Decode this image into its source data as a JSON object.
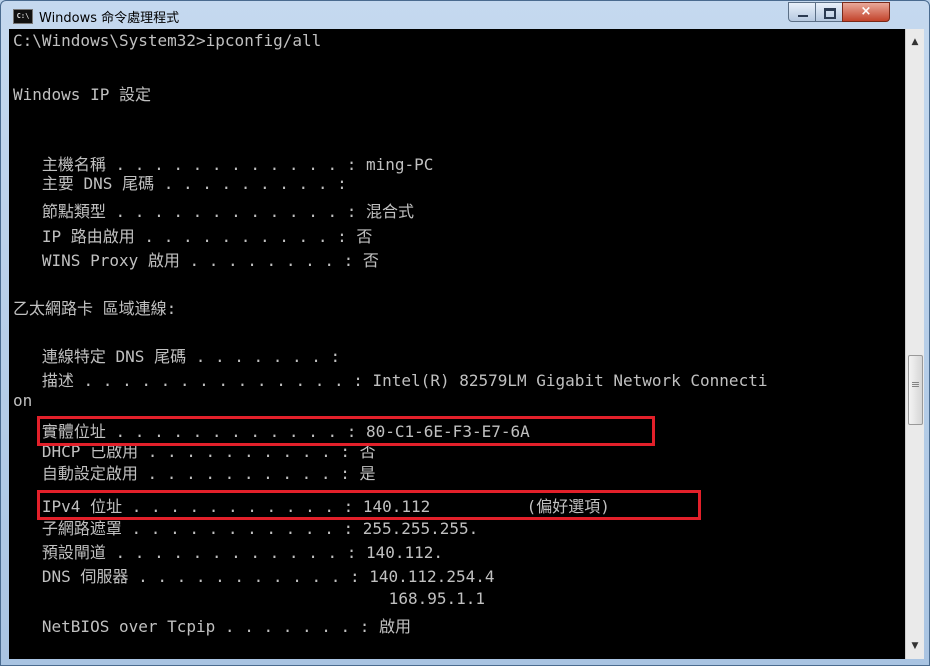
{
  "window": {
    "title": "Windows 命令處理程式",
    "icon": "cmd-icon",
    "controls": {
      "minimize": "minimize-icon",
      "maximize": "maximize-icon",
      "close": "×"
    }
  },
  "console": {
    "lines": [
      "C:\\Windows\\System32>ipconfig/all",
      "",
      "Windows IP 設定",
      "",
      "   主機名稱 . . . . . . . . . . . . : ming-PC",
      "   主要 DNS 尾碼 . . . . . . . . . :",
      "   節點類型 . . . . . . . . . . . . : 混合式",
      "   IP 路由啟用 . . . . . . . . . . : 否",
      "   WINS Proxy 啟用 . . . . . . . . : 否",
      "",
      "乙太網路卡 區域連線:",
      "",
      "   連線特定 DNS 尾碼 . . . . . . . :",
      "   描述 . . . . . . . . . . . . . . : Intel(R) 82579LM Gigabit Network Connecti",
      "on",
      "   實體位址 . . . . . . . . . . . . : 80-C1-6E-F3-E7-6A",
      "   DHCP 已啟用 . . . . . . . . . . : 否",
      "   自動設定啟用 . . . . . . . . . . : 是",
      "   IPv4 位址 . . . . . . . . . . . : 140.112          (偏好選項)",
      "   子網路遮罩 . . . . . . . . . . . : 255.255.255.",
      "   預設閘道 . . . . . . . . . . . . : 140.112.",
      "   DNS 伺服器 . . . . . . . . . . . : 140.112.254.4",
      "                                       168.95.1.1",
      "   NetBIOS over Tcpip . . . . . . . : 啟用"
    ]
  },
  "scrollbar": {
    "up": "▲",
    "down": "▼"
  },
  "colors": {
    "console_bg": "#000000",
    "console_text": "#c0c0c0",
    "highlight": "#e2202a"
  }
}
